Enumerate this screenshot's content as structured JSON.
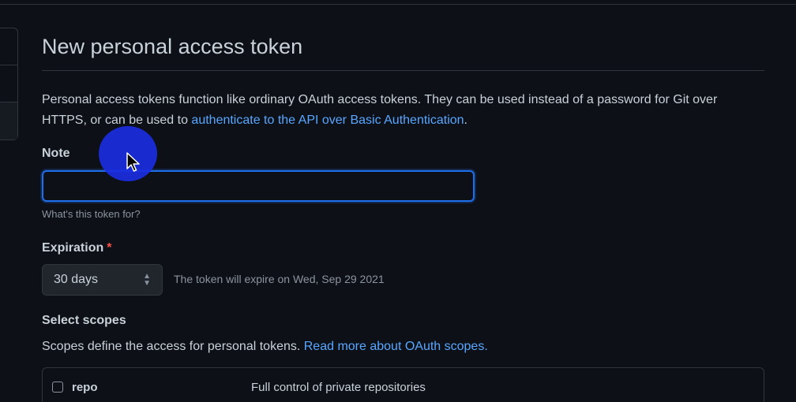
{
  "page": {
    "title": "New personal access token",
    "description_text": "Personal access tokens function like ordinary OAuth access tokens. They can be used instead of a password for Git over HTTPS, or can be used to ",
    "description_link": "authenticate to the API over Basic Authentication",
    "description_end": "."
  },
  "note": {
    "label": "Note",
    "value": "",
    "placeholder": "",
    "hint": "What's this token for?"
  },
  "expiration": {
    "label": "Expiration",
    "required_mark": "*",
    "selected": "30 days",
    "note": "The token will expire on Wed, Sep 29 2021"
  },
  "scopes": {
    "label": "Select scopes",
    "description": "Scopes define the access for personal tokens. ",
    "link": "Read more about OAuth scopes.",
    "items": [
      {
        "name": "repo",
        "description": "Full control of private repositories",
        "checked": false
      }
    ]
  },
  "colors": {
    "background": "#0d1117",
    "link": "#58a6ff",
    "focus_border": "#1f6feb",
    "required": "#f85149",
    "cursor_highlight": "#1a2de0"
  },
  "icons": [
    "cursor-arrow-icon",
    "sort-arrows-icon",
    "checkbox-icon"
  ]
}
